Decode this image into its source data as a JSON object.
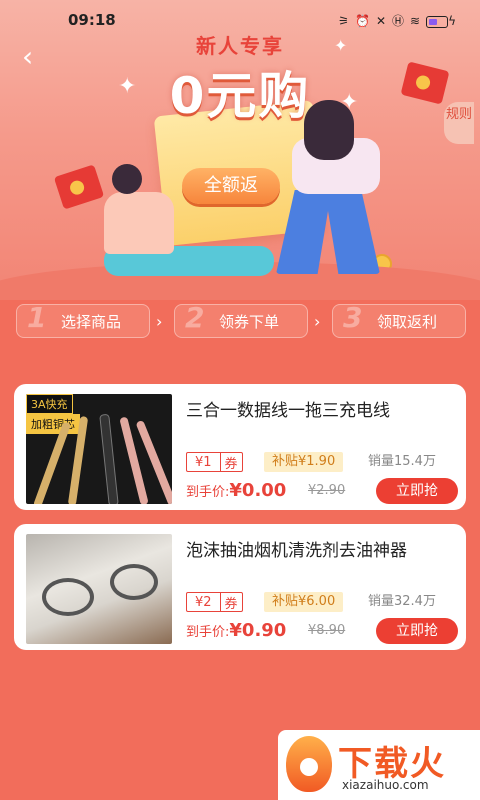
{
  "status": {
    "time": "09:18"
  },
  "banner": {
    "subtitle": "新人专享",
    "title": "0元购",
    "rules_label": "规则",
    "badge": "全额返"
  },
  "steps": [
    {
      "num": "1",
      "label": "选择商品"
    },
    {
      "num": "2",
      "label": "领券下单"
    },
    {
      "num": "3",
      "label": "领取返利"
    }
  ],
  "products": [
    {
      "title": "三合一数据线一拖三充电线",
      "thumb_tag": "3A快充",
      "thumb_sub": "加粗铜芯",
      "coupon": "¥1",
      "coupon_suffix": "券",
      "subsidy": "补贴¥1.90",
      "sales": "销量15.4万",
      "final_label": "到手价:",
      "final_price": "¥0.00",
      "original_price": "¥2.90",
      "buy_label": "立即抢"
    },
    {
      "title": "泡沫抽油烟机清洗剂去油神器",
      "coupon": "¥2",
      "coupon_suffix": "券",
      "subsidy": "补贴¥6.00",
      "sales": "销量32.4万",
      "final_label": "到手价:",
      "final_price": "¥0.90",
      "original_price": "¥8.90",
      "buy_label": "立即抢"
    }
  ],
  "watermark": {
    "text": "下载火",
    "url": "xiazaihuo.com"
  },
  "colors": {
    "accent": "#e8433a",
    "background": "#f26d5b",
    "buy_button": "#ec3f33",
    "subsidy_bg": "#fdeec7"
  }
}
